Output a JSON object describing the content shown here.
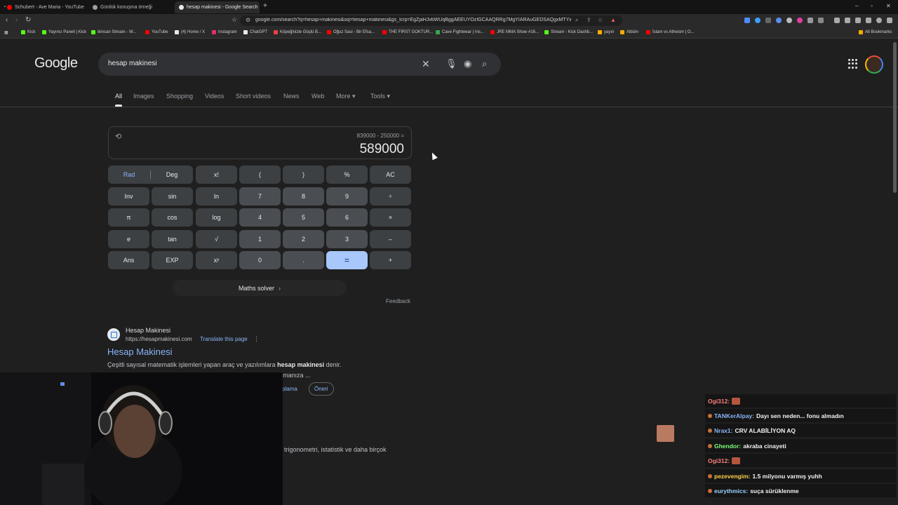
{
  "browser": {
    "tabs": [
      {
        "title": "Schubert - Ave Maria - YouTube",
        "favicon_color": "#ff0000"
      },
      {
        "title": "Günlük konuşma örneği",
        "favicon_color": "#9aa0a6"
      },
      {
        "title": "hesap makinesi - Google Search",
        "favicon_color": "#e8e8e8",
        "active": true
      }
    ],
    "new_tab_symbol": "+",
    "window_controls": [
      "–",
      "▫",
      "✕"
    ],
    "url": "google.com/search?q=hesap+makinesi&oq=hesap+makinesi&gs_lcrp=EgZjaHJvbWUqBggAEEUYOzIGCAAQRRg7MgYIARAuGEDSAQgxMTYxaj...",
    "bookmarks": [
      {
        "label": "Kick",
        "color": "#53fc18"
      },
      {
        "label": "Yayıncı Paneli | Kick",
        "color": "#53fc18"
      },
      {
        "label": "ikinsan Stream - W...",
        "color": "#53fc18"
      },
      {
        "label": "YouTube",
        "color": "#ff0000"
      },
      {
        "label": "(4) Home / X",
        "color": "#e8e8e8"
      },
      {
        "label": "Instagram",
        "color": "#e1306c"
      },
      {
        "label": "ChatGPT",
        "color": "#e8e8e8"
      },
      {
        "label": "Köpeğinizle Güçlü B...",
        "color": "#e84040"
      },
      {
        "label": "Oğuz Sasi - Bir Efsa...",
        "color": "#ff0000"
      },
      {
        "label": "THE FIRST GOKTUR...",
        "color": "#ff0000"
      },
      {
        "label": "Cave Fightwear | Ins...",
        "color": "#34a853"
      },
      {
        "label": "JRE MMA Show #16...",
        "color": "#ff0000"
      },
      {
        "label": "Stream - Kick Dashb...",
        "color": "#53fc18"
      },
      {
        "label": "yayın",
        "color": "#f9ab00"
      },
      {
        "label": "Albüm",
        "color": "#f9ab00"
      },
      {
        "label": "İslam vs Atheism | O...",
        "color": "#ff0000"
      }
    ],
    "all_bookmarks": "All Bookmarks"
  },
  "google": {
    "logo": "Google",
    "query": "hesap makinesi",
    "tabs": [
      "All",
      "Images",
      "Shopping",
      "Videos",
      "Short videos",
      "News",
      "Web",
      "More ▾",
      "Tools ▾"
    ],
    "calculator": {
      "expression": "839000 - 250000 =",
      "result": "589000",
      "rad": "Rad",
      "deg": "Deg",
      "keys": [
        [
          "x!",
          "(",
          ")",
          "%",
          "AC"
        ],
        [
          "Inv",
          "sin",
          "ln",
          "7",
          "8",
          "9",
          "÷"
        ],
        [
          "π",
          "cos",
          "log",
          "4",
          "5",
          "6",
          "×"
        ],
        [
          "e",
          "tan",
          "√",
          "1",
          "2",
          "3",
          "–"
        ],
        [
          "Ans",
          "EXP",
          "xʸ",
          "0",
          ".",
          "=",
          "+"
        ]
      ],
      "maths_solver": "Maths solver",
      "feedback": "Feedback"
    },
    "result": {
      "site": "Hesap Makinesi",
      "url": "https://hesapmakinesi.com",
      "translate": "Translate this page",
      "title": "Hesap Makinesi",
      "snippet_pre": "Çeşitli sayısal matematik işlemleri yapan araç ve yazılımlara ",
      "snippet_bold": "hesap makinesi",
      "snippet_post": " denir.",
      "snippet_line2": "manıza ...",
      "chips": [
        "plama",
        "Öneri"
      ],
      "second_snippet": "trigonometri, istatistik ve daha birçok"
    }
  },
  "chat": [
    {
      "user": "Ogi312:",
      "color": "#ff7f7f",
      "msg": "",
      "emote": true
    },
    {
      "user": "TANKerAlpay:",
      "color": "#8ab4f8",
      "msg": "Dayı sen neden... fonu almadın",
      "emote": false
    },
    {
      "user": "Nrax1:",
      "color": "#8ab4f8",
      "msg": "CRV ALABİLİYON AQ",
      "emote": false
    },
    {
      "user": "Ghendor:",
      "color": "#7bff7b",
      "msg": "akraba cinayeti",
      "emote": false
    },
    {
      "user": "Ogi312:",
      "color": "#ff7f7f",
      "msg": "",
      "emote": true
    },
    {
      "user": "pezevengim:",
      "color": "#ffd24d",
      "msg": "1.5 milyonu varmış yuhh",
      "emote": false
    },
    {
      "user": "eurythmics:",
      "color": "#9ad0ff",
      "msg": "suça sürüklenme",
      "emote": false
    }
  ]
}
